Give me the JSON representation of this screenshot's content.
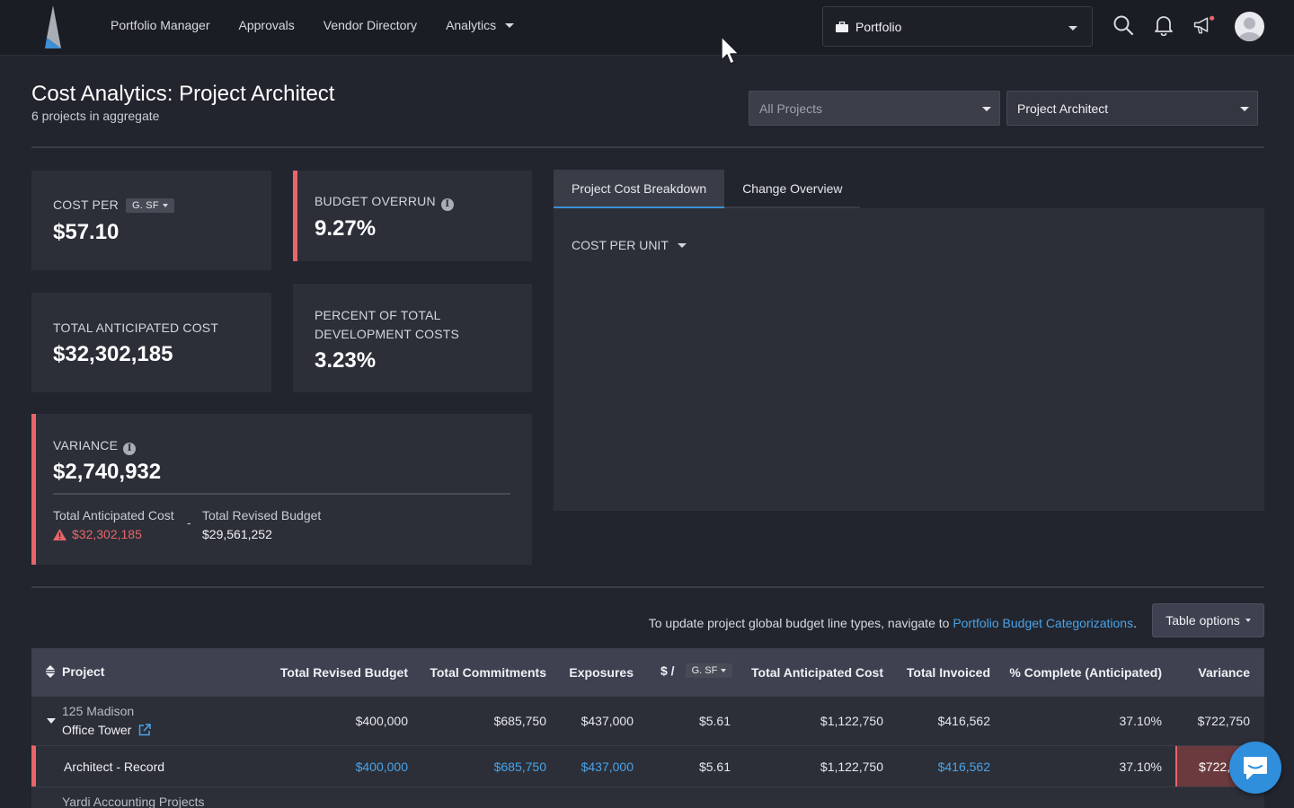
{
  "nav": {
    "items": [
      "Portfolio Manager",
      "Approvals",
      "Vendor Directory",
      "Analytics"
    ],
    "portfolio_selector": "Portfolio"
  },
  "page": {
    "title": "Cost Analytics: Project Architect",
    "subtitle": "6 projects in aggregate",
    "filter_projects": "All Projects",
    "filter_category": "Project Architect"
  },
  "cards": {
    "cost_per": {
      "label": "COST PER",
      "unit": "G. SF",
      "value": "$57.10"
    },
    "budget_overrun": {
      "label": "BUDGET OVERRUN",
      "value": "9.27%"
    },
    "total_anticipated": {
      "label": "TOTAL ANTICIPATED COST",
      "value": "$32,302,185"
    },
    "percent_dev": {
      "label_line1": "PERCENT OF TOTAL",
      "label_line2": "DEVELOPMENT COSTS",
      "value": "3.23%"
    },
    "variance": {
      "label": "VARIANCE",
      "value": "$2,740,932",
      "left_label": "Total Anticipated Cost",
      "left_value": "$32,302,185",
      "operator": "-",
      "right_label": "Total Revised Budget",
      "right_value": "$29,561,252"
    }
  },
  "tabs": {
    "breakdown": "Project Cost Breakdown",
    "changes": "Change Overview",
    "cost_per_unit": "COST PER UNIT"
  },
  "notice": {
    "text": "To update project global budget line types, navigate to ",
    "link": "Portfolio Budget Categorizations",
    "suffix": ".",
    "table_options": "Table options"
  },
  "table": {
    "headers": {
      "project": "Project",
      "revised_budget": "Total Revised Budget",
      "commitments": "Total Commitments",
      "exposures": "Exposures",
      "per_unit": "$ /",
      "per_unit_pill": "G. SF",
      "anticipated": "Total Anticipated Cost",
      "invoiced": "Total Invoiced",
      "complete": "% Complete (Anticipated)",
      "variance": "Variance"
    },
    "rows": [
      {
        "name_line1": "125 Madison",
        "name_line2": "Office Tower",
        "revised_budget": "$400,000",
        "commitments": "$685,750",
        "exposures": "$437,000",
        "per_unit": "$5.61",
        "anticipated": "$1,122,750",
        "invoiced": "$416,562",
        "complete": "37.10%",
        "variance": "$722,750"
      },
      {
        "name": "Architect - Record",
        "revised_budget": "$400,000",
        "commitments": "$685,750",
        "exposures": "$437,000",
        "per_unit": "$5.61",
        "anticipated": "$1,122,750",
        "invoiced": "$416,562",
        "complete": "37.10%",
        "variance": "$722,"
      },
      {
        "name_line1": "Yardi Accounting Projects"
      }
    ]
  }
}
